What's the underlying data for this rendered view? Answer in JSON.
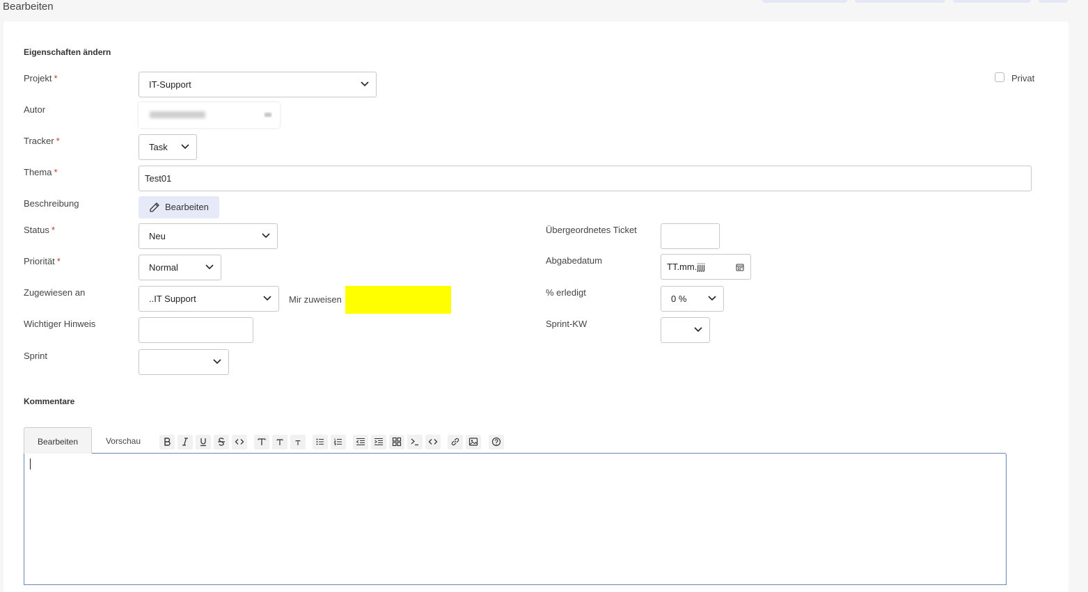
{
  "page": {
    "title": "Bearbeiten"
  },
  "section_properties": {
    "heading": "Eigenschaften ändern"
  },
  "fields": {
    "projekt": {
      "label": "Projekt",
      "value": "IT-Support"
    },
    "autor": {
      "label": "Autor"
    },
    "tracker": {
      "label": "Tracker",
      "value": "Task"
    },
    "thema": {
      "label": "Thema",
      "value": "Test01"
    },
    "beschreibung": {
      "label": "Beschreibung",
      "button": "Bearbeiten"
    },
    "status": {
      "label": "Status",
      "value": "Neu"
    },
    "prioritaet": {
      "label": "Priorität",
      "value": "Normal"
    },
    "zugewiesen": {
      "label": "Zugewiesen an",
      "value": "..IT Support",
      "assign_me": "Mir zuweisen"
    },
    "hinweis": {
      "label": "Wichtiger Hinweis",
      "value": ""
    },
    "sprint": {
      "label": "Sprint",
      "value": ""
    },
    "uebergeordnet": {
      "label": "Übergeordnetes Ticket",
      "value": ""
    },
    "abgabedatum": {
      "label": "Abgabedatum",
      "placeholder": "TT.mm.jjjj"
    },
    "erledigt": {
      "label": "% erledigt",
      "value": "0 %"
    },
    "sprint_kw": {
      "label": "Sprint-KW",
      "value": ""
    },
    "privat": {
      "label": "Privat",
      "checked": false
    }
  },
  "required_marker": "*",
  "comments": {
    "heading": "Kommentare",
    "tabs": [
      "Bearbeiten",
      "Vorschau"
    ],
    "toolbar": [
      "bold-icon",
      "italic-icon",
      "underline-icon",
      "strikethrough-icon",
      "inline-code-icon",
      "heading1-icon",
      "heading2-icon",
      "heading3-icon",
      "bullet-list-icon",
      "numbered-list-icon",
      "outdent-icon",
      "indent-icon",
      "table-icon",
      "code-block-icon",
      "html-icon",
      "link-icon",
      "image-icon",
      "help-icon"
    ],
    "text": ""
  },
  "colors": {
    "highlight": "#ffff00",
    "button_bg": "#e6e9f7",
    "editor_border": "#6b86b3"
  }
}
